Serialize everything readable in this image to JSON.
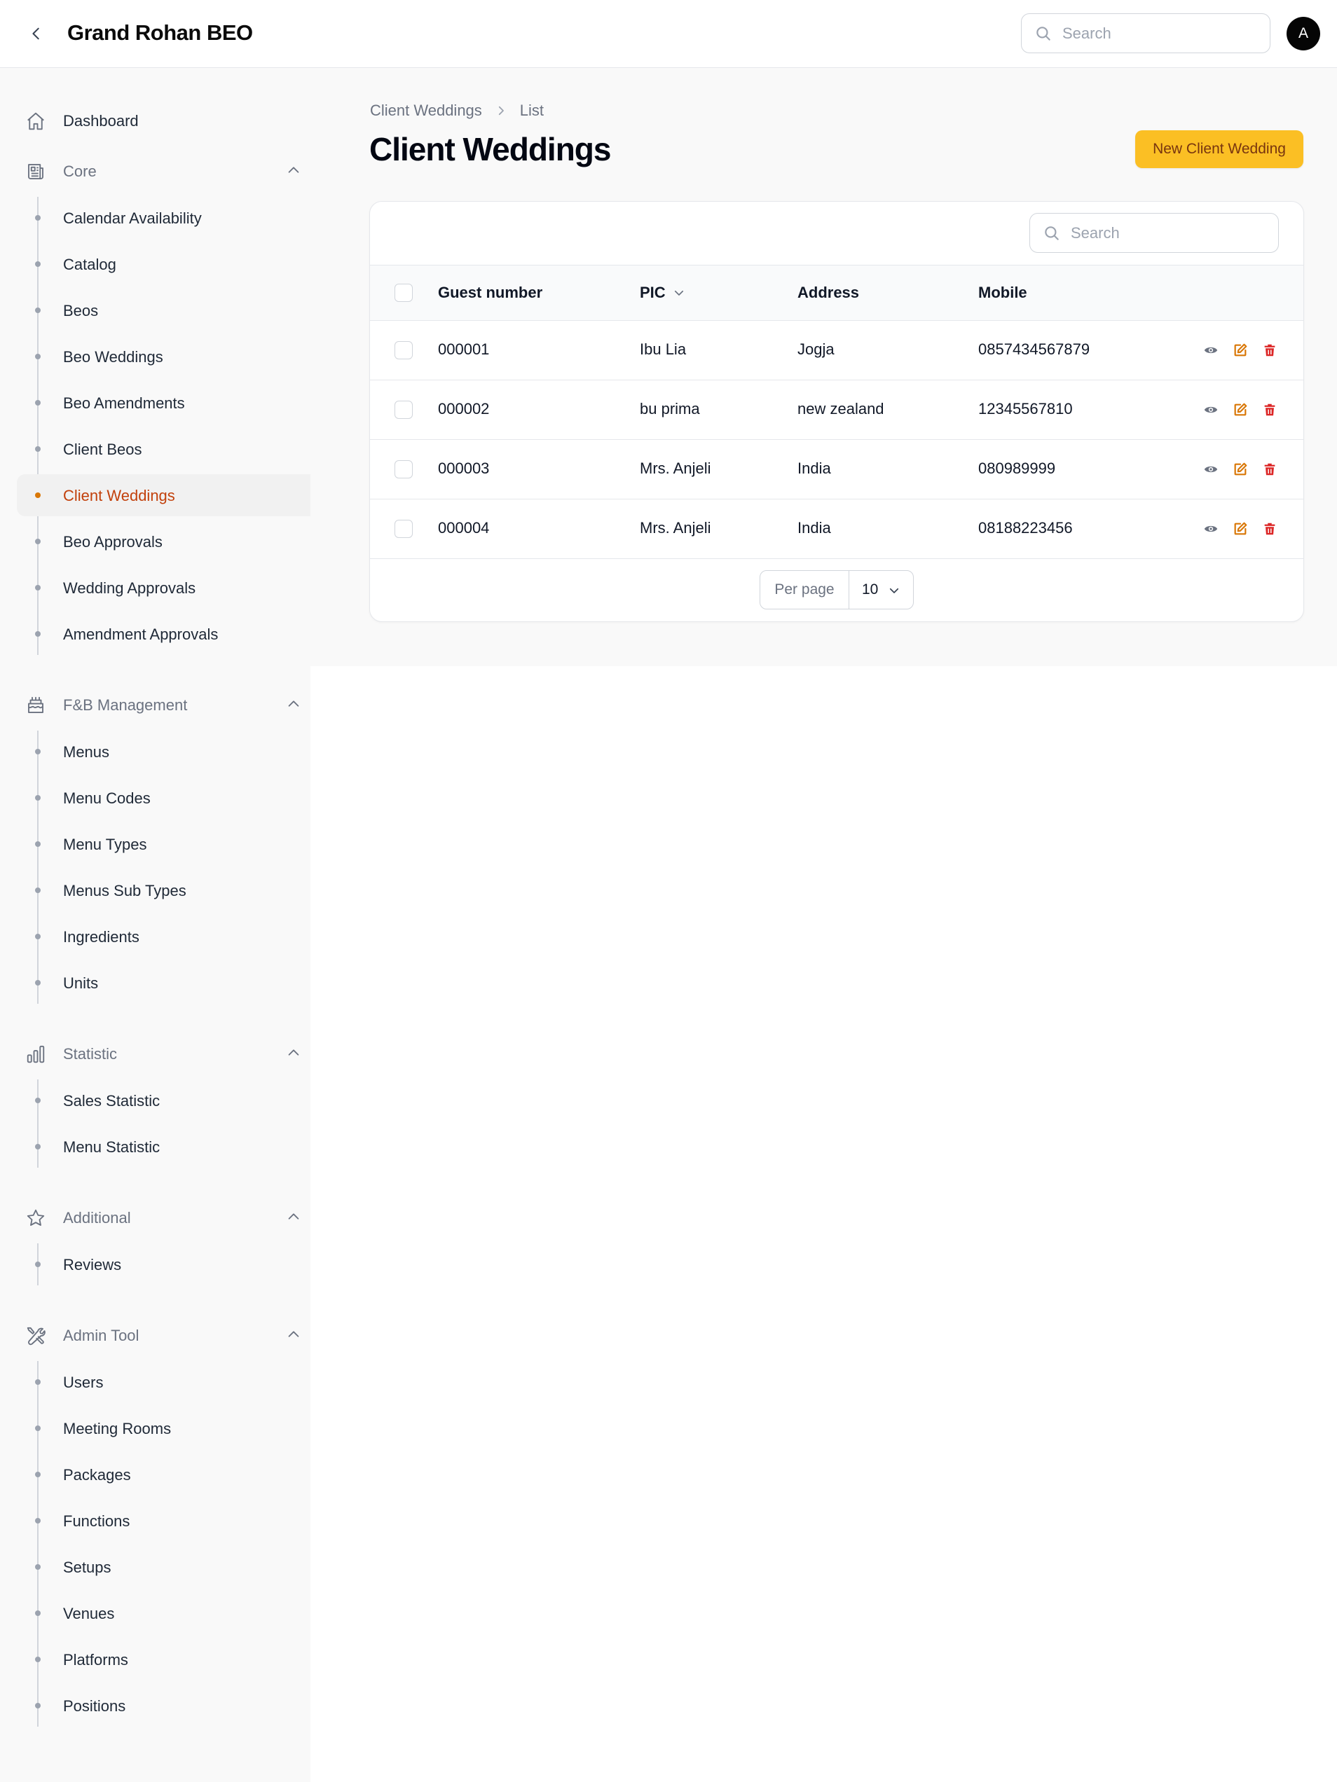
{
  "app": {
    "title": "Grand Rohan BEO",
    "avatar_initial": "A",
    "search_placeholder": "Search"
  },
  "sidebar": {
    "dashboard": {
      "label": "Dashboard",
      "icon": "home-icon"
    },
    "groups": [
      {
        "label": "Core",
        "icon": "newspaper-icon",
        "items": [
          "Calendar Availability",
          "Catalog",
          "Beos",
          "Beo Weddings",
          "Beo Amendments",
          "Client Beos",
          "Client Weddings",
          "Beo Approvals",
          "Wedding Approvals",
          "Amendment Approvals"
        ],
        "active": "Client Weddings"
      },
      {
        "label": "F&B Management",
        "icon": "cake-icon",
        "items": [
          "Menus",
          "Menu Codes",
          "Menu Types",
          "Menus Sub Types",
          "Ingredients",
          "Units"
        ]
      },
      {
        "label": "Statistic",
        "icon": "chart-bar-icon",
        "items": [
          "Sales Statistic",
          "Menu Statistic"
        ]
      },
      {
        "label": "Additional",
        "icon": "star-icon",
        "items": [
          "Reviews"
        ]
      },
      {
        "label": "Admin Tool",
        "icon": "wrench-screwdriver-icon",
        "items": [
          "Users",
          "Meeting Rooms",
          "Packages",
          "Functions",
          "Setups",
          "Venues",
          "Platforms",
          "Positions"
        ]
      }
    ]
  },
  "breadcrumb": {
    "parent": "Client Weddings",
    "current": "List"
  },
  "page": {
    "title": "Client Weddings",
    "new_button": "New Client Wedding"
  },
  "table": {
    "search_placeholder": "Search",
    "columns": [
      "Guest number",
      "PIC",
      "Address",
      "Mobile"
    ],
    "sorted_column": "PIC",
    "rows": [
      {
        "guest_number": "000001",
        "pic": "Ibu Lia",
        "address": "Jogja",
        "mobile": "0857434567879"
      },
      {
        "guest_number": "000002",
        "pic": "bu prima",
        "address": "new zealand",
        "mobile": "12345567810"
      },
      {
        "guest_number": "000003",
        "pic": "Mrs. Anjeli",
        "address": "India",
        "mobile": "080989999"
      },
      {
        "guest_number": "000004",
        "pic": "Mrs. Anjeli",
        "address": "India",
        "mobile": "08188223456"
      }
    ],
    "per_page_label": "Per page",
    "per_page_value": "10"
  },
  "colors": {
    "accent": "#fbbf24",
    "active_text": "#c2410c",
    "edit": "#d97706",
    "delete": "#dc2626",
    "view": "#6b7280"
  }
}
